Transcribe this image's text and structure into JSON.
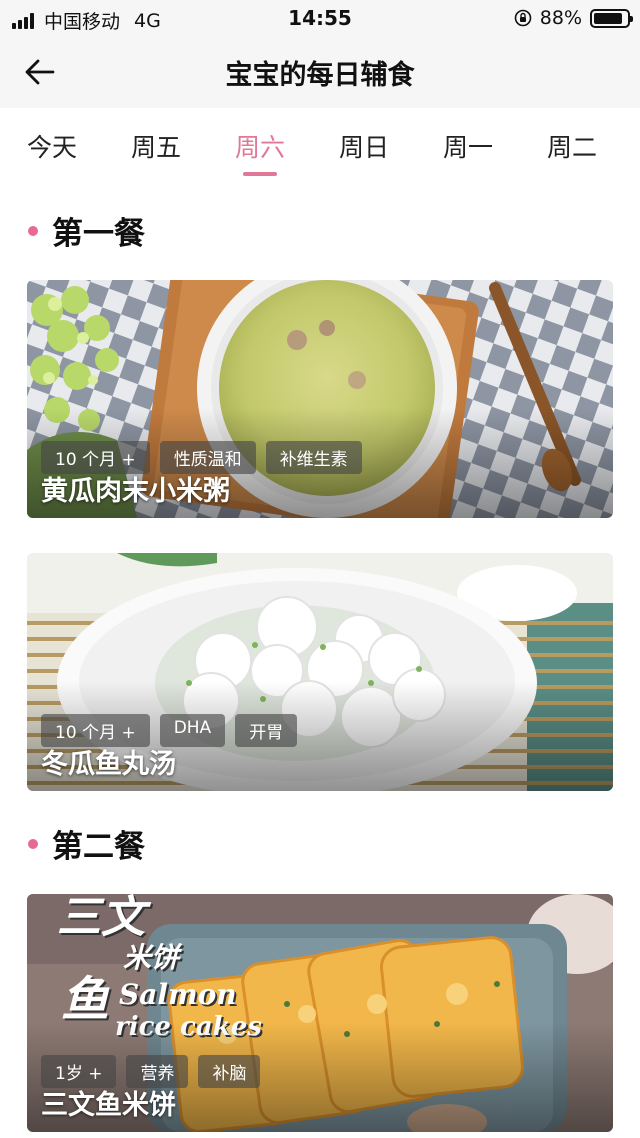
{
  "status_bar": {
    "carrier": "中国移动",
    "network": "4G",
    "time": "14:55",
    "battery": "88%",
    "battery_level": 0.88
  },
  "header": {
    "title": "宝宝的每日辅食",
    "back_icon": "back-arrow-icon"
  },
  "tabs": [
    {
      "label": "今天",
      "active": false
    },
    {
      "label": "周五",
      "active": false
    },
    {
      "label": "周六",
      "active": true
    },
    {
      "label": "周日",
      "active": false
    },
    {
      "label": "周一",
      "active": false
    },
    {
      "label": "周二",
      "active": false
    }
  ],
  "colors": {
    "accent": "#e07897",
    "section_dot": "#e86a92"
  },
  "sections": [
    {
      "title": "第一餐",
      "cards": [
        {
          "tags": [
            "10 个月 +",
            "性质温和",
            "补维生素"
          ],
          "title": "黄瓜肉末小米粥"
        },
        {
          "tags": [
            "10 个月 +",
            "DHA",
            "开胃"
          ],
          "title": "冬瓜鱼丸汤"
        }
      ]
    },
    {
      "title": "第二餐",
      "cards": [
        {
          "tags": [
            "1岁 +",
            "营养",
            "补脑"
          ],
          "title": "三文鱼米饼",
          "image_text": {
            "line1": "三文",
            "line2": "鱼",
            "cn": "米饼",
            "en1": "Salmon",
            "en2": "rice cakes"
          }
        }
      ]
    }
  ]
}
